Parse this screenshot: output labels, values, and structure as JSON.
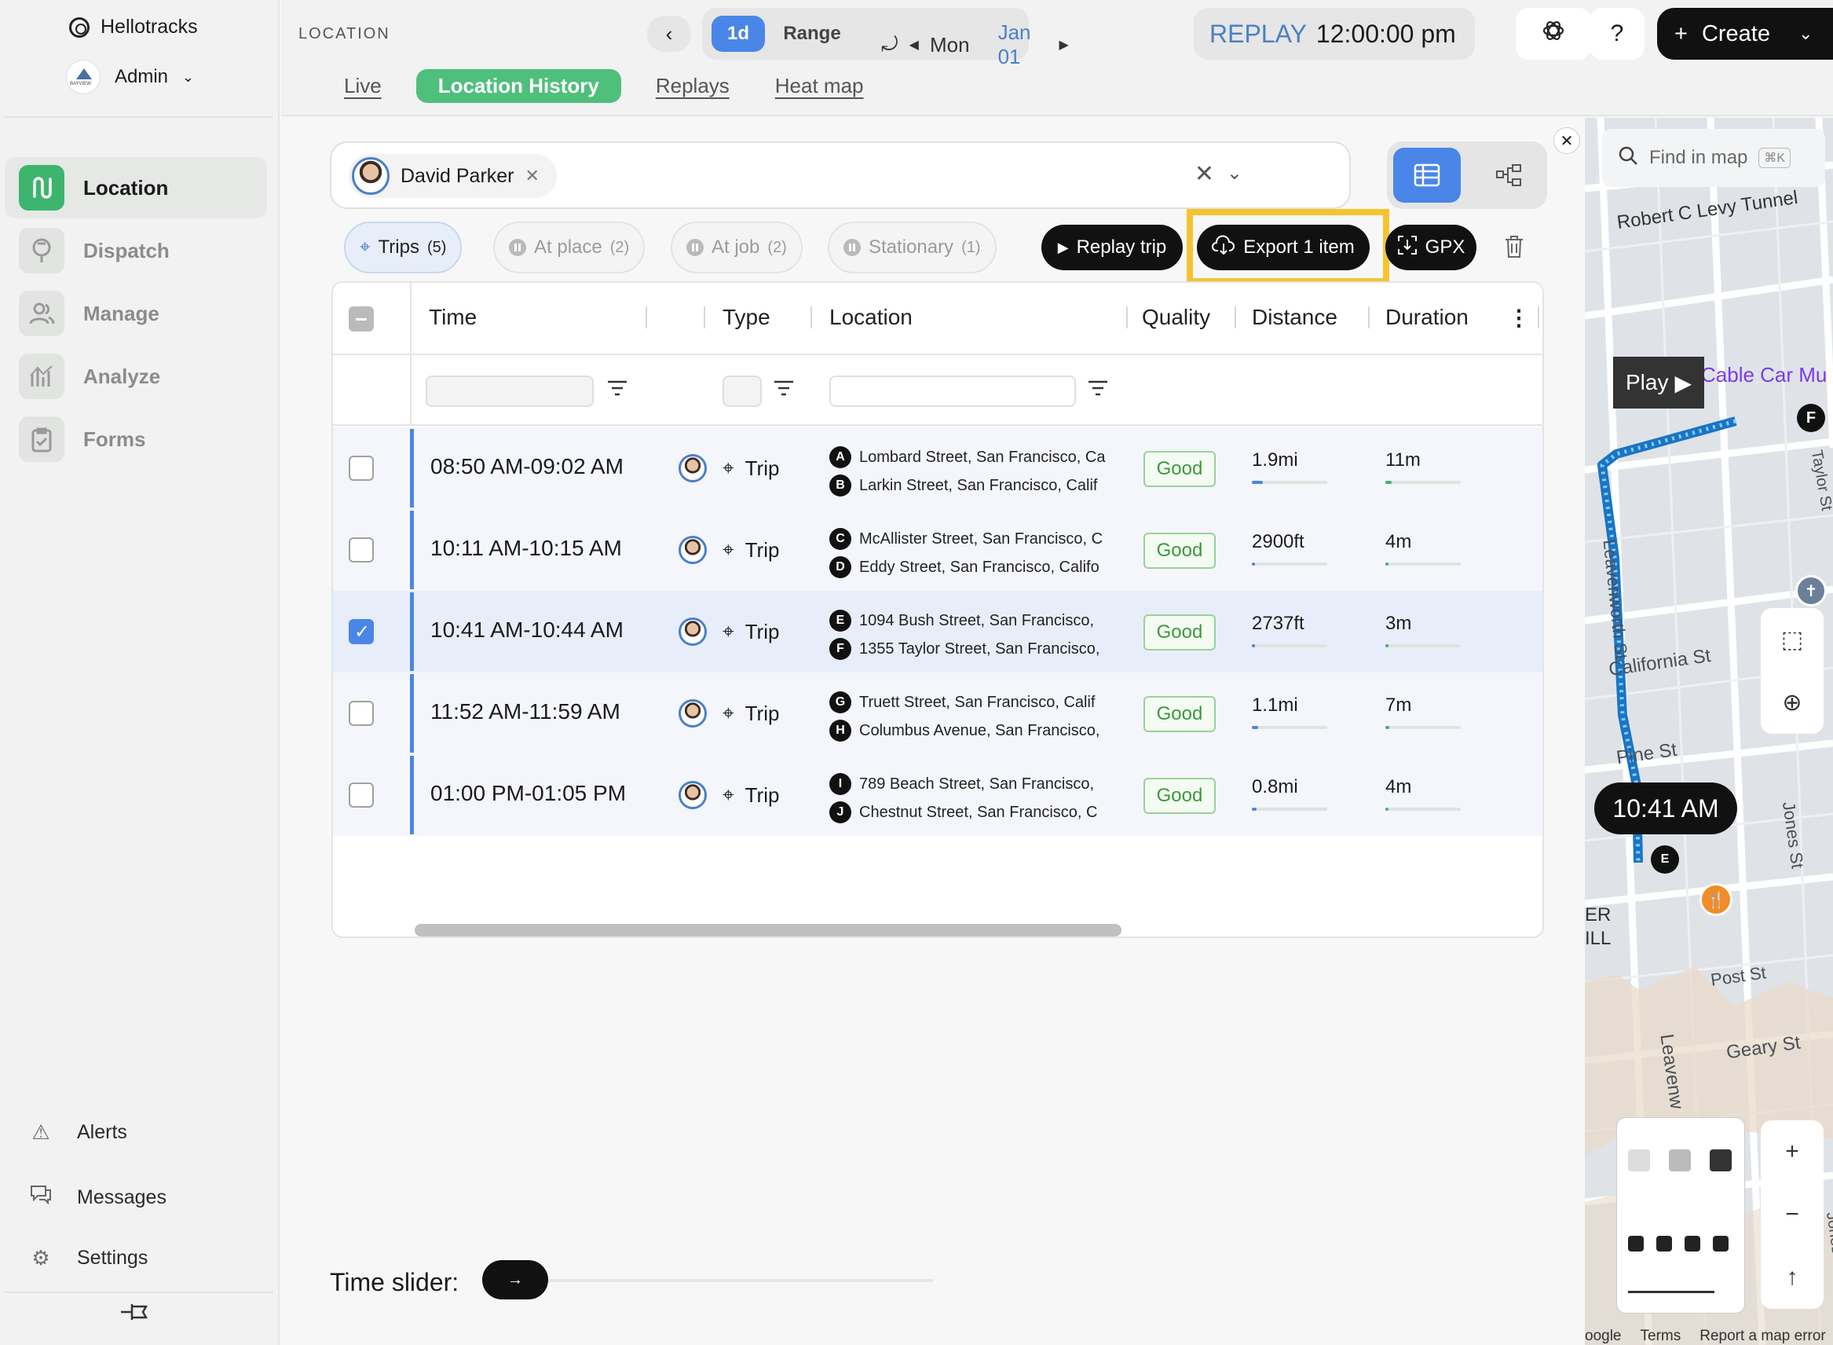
{
  "app": {
    "brand": "Hellotracks",
    "user": "Admin"
  },
  "sidebar": {
    "items": [
      {
        "label": "Location",
        "icon": "location-path-icon",
        "active": true
      },
      {
        "label": "Dispatch",
        "icon": "dispatch-icon",
        "active": false
      },
      {
        "label": "Manage",
        "icon": "manage-users-icon",
        "active": false
      },
      {
        "label": "Analyze",
        "icon": "analyze-chart-icon",
        "active": false
      },
      {
        "label": "Forms",
        "icon": "forms-clipboard-icon",
        "active": false
      }
    ],
    "bottom": [
      {
        "label": "Alerts",
        "icon": "alert-icon"
      },
      {
        "label": "Messages",
        "icon": "messages-icon"
      },
      {
        "label": "Settings",
        "icon": "settings-gear-icon"
      }
    ]
  },
  "header": {
    "section": "LOCATION",
    "range": {
      "day": "1d",
      "range": "Range"
    },
    "date": {
      "weekday": "Mon",
      "date": "Jan 01"
    },
    "replay": {
      "label": "REPLAY",
      "time": "12:00:00 pm"
    },
    "help": "?",
    "create": "Create",
    "tabs": [
      {
        "label": "Live",
        "active": false
      },
      {
        "label": "Location History",
        "active": true
      },
      {
        "label": "Replays",
        "active": false
      },
      {
        "label": "Heat map",
        "active": false
      }
    ]
  },
  "panel": {
    "person": "David Parker",
    "filters": [
      {
        "label": "Trips",
        "count": "(5)",
        "active": true
      },
      {
        "label": "At place",
        "count": "(2)",
        "active": false
      },
      {
        "label": "At job",
        "count": "(2)",
        "active": false
      },
      {
        "label": "Stationary",
        "count": "(1)",
        "active": false
      }
    ],
    "actions": {
      "replay": "Replay trip",
      "export": "Export 1 item",
      "gpx": "GPX"
    },
    "columns": [
      "Time",
      "Type",
      "Location",
      "Quality",
      "Distance",
      "Duration"
    ],
    "rows": [
      {
        "time": "08:50 AM-09:02 AM",
        "type": "Trip",
        "m1": "A",
        "from": "Lombard Street, San Francisco, Ca",
        "m2": "B",
        "to": "Larkin Street, San Francisco, Calif",
        "quality": "Good",
        "distance": "1.9mi",
        "dist_level": 0.15,
        "duration": "11m",
        "dur_level": 0.08,
        "selected": false
      },
      {
        "time": "10:11 AM-10:15 AM",
        "type": "Trip",
        "m1": "C",
        "from": "McAllister Street, San Francisco, C",
        "m2": "D",
        "to": "Eddy Street, San Francisco, Califo",
        "quality": "Good",
        "distance": "2900ft",
        "dist_level": 0.03,
        "duration": "4m",
        "dur_level": 0.03,
        "selected": false
      },
      {
        "time": "10:41 AM-10:44 AM",
        "type": "Trip",
        "m1": "E",
        "from": "1094 Bush Street, San Francisco,",
        "m2": "F",
        "to": "1355 Taylor Street, San Francisco,",
        "quality": "Good",
        "distance": "2737ft",
        "dist_level": 0.03,
        "duration": "3m",
        "dur_level": 0.03,
        "selected": true
      },
      {
        "time": "11:52 AM-11:59 AM",
        "type": "Trip",
        "m1": "G",
        "from": "Truett Street, San Francisco, Calif",
        "m2": "H",
        "to": "Columbus Avenue, San Francisco,",
        "quality": "Good",
        "distance": "1.1mi",
        "dist_level": 0.08,
        "duration": "7m",
        "dur_level": 0.05,
        "selected": false
      },
      {
        "time": "01:00 PM-01:05 PM",
        "type": "Trip",
        "m1": "I",
        "from": "789 Beach Street, San Francisco,",
        "m2": "J",
        "to": "Chestnut Street, San Francisco, C",
        "quality": "Good",
        "distance": "0.8mi",
        "dist_level": 0.06,
        "duration": "4m",
        "dur_level": 0.03,
        "selected": false
      }
    ],
    "time_slider": "Time slider:"
  },
  "map": {
    "search": "Find in map",
    "shortcut": "⌘K",
    "streets": {
      "robert": "Robert C Levy Tunnel",
      "cable": "Cable Car Mu",
      "taylor": "Taylor St",
      "leaven": "Leavenworth St",
      "california": "California St",
      "pine": "Pine St",
      "jones": "Jones St",
      "post": "Post St",
      "geary": "Geary St",
      "leaven2": "Leavenw",
      "jones2": "Jones St",
      "hill": "ER\nILL"
    },
    "play": "Play",
    "time": "10:41 AM",
    "end_marker": "F",
    "start_marker": "E",
    "footer": {
      "google": "oogle",
      "terms": "Terms",
      "report": "Report a map error"
    },
    "colors": {
      "route": "#2e9fe6",
      "accent": "#4a86e8",
      "green": "#3db56f",
      "highlight": "#f4c430"
    }
  }
}
